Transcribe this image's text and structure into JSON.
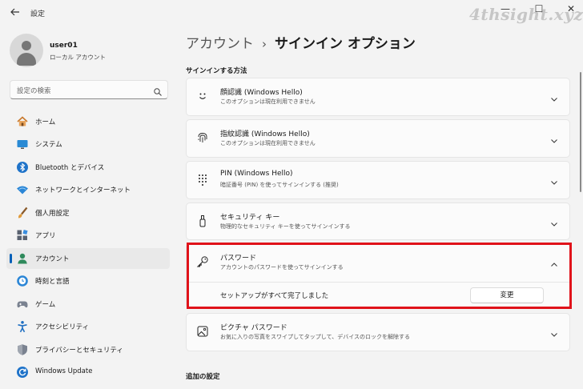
{
  "window": {
    "title": "設定",
    "back_icon": "back-arrow-icon",
    "controls": {
      "minimize": "—",
      "maximize": "☐",
      "close": "✕"
    },
    "watermark": "4thsight.xyz"
  },
  "user": {
    "name": "user01",
    "type": "ローカル アカウント"
  },
  "search": {
    "placeholder": "設定の検索"
  },
  "sidebar": {
    "items": [
      {
        "label": "ホーム",
        "icon": "home-icon"
      },
      {
        "label": "システム",
        "icon": "system-icon"
      },
      {
        "label": "Bluetooth とデバイス",
        "icon": "bluetooth-icon"
      },
      {
        "label": "ネットワークとインターネット",
        "icon": "network-icon"
      },
      {
        "label": "個人用設定",
        "icon": "brush-icon"
      },
      {
        "label": "アプリ",
        "icon": "apps-icon"
      },
      {
        "label": "アカウント",
        "icon": "account-icon",
        "selected": true
      },
      {
        "label": "時刻と言語",
        "icon": "time-language-icon"
      },
      {
        "label": "ゲーム",
        "icon": "gaming-icon"
      },
      {
        "label": "アクセシビリティ",
        "icon": "accessibility-icon"
      },
      {
        "label": "プライバシーとセキュリティ",
        "icon": "shield-icon"
      },
      {
        "label": "Windows Update",
        "icon": "windows-update-icon"
      }
    ]
  },
  "header": {
    "parent": "アカウント",
    "separator": "›",
    "current": "サインイン オプション"
  },
  "sections": {
    "signin_methods": "サインインする方法",
    "additional": "追加の設定"
  },
  "options": [
    {
      "title": "顔認識 (Windows Hello)",
      "subtitle": "このオプションは現在利用できません",
      "icon": "face-icon"
    },
    {
      "title": "指紋認識 (Windows Hello)",
      "subtitle": "このオプションは現在利用できません",
      "icon": "fingerprint-icon"
    },
    {
      "title": "PIN (Windows Hello)",
      "subtitle": "暗証番号 (PIN) を使ってサインインする (推奨)",
      "icon": "pin-keypad-icon"
    },
    {
      "title": "セキュリティ キー",
      "subtitle": "物理的なセキュリティ キーを使ってサインインする",
      "icon": "security-key-icon"
    },
    {
      "title": "パスワード",
      "subtitle": "アカウントのパスワードを使ってサインインする",
      "icon": "key-icon",
      "expanded": true
    },
    {
      "title": "ピクチャ パスワード",
      "subtitle": "お気に入りの写真をスワイプしてタップして、デバイスのロックを解除する",
      "icon": "picture-icon"
    }
  ],
  "password_panel": {
    "status": "セットアップがすべて完了しました",
    "change_label": "変更"
  },
  "colors": {
    "accent": "#005fb8",
    "highlight": "#e0121a",
    "background": "#f3f3f3"
  }
}
